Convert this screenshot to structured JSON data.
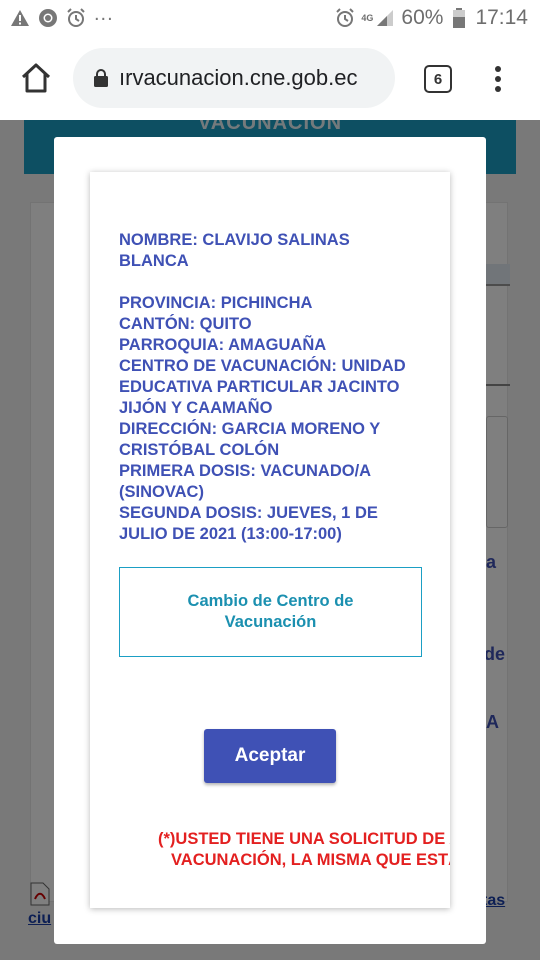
{
  "status_bar": {
    "left_icons": [
      "warning-icon",
      "chrome-icon",
      "alarm-icon"
    ],
    "more": "...",
    "network": "4G",
    "battery": "60%",
    "time": "17:14"
  },
  "browser": {
    "url": "ırvacunacion.cne.gob.ec",
    "tab_count": "6"
  },
  "background_page": {
    "header_title": "VACUNACION",
    "partial_text_1": "a",
    "partial_text_2": "de",
    "partial_text_3": "A",
    "footer_link_1": "ciu",
    "footer_link_2": "tas"
  },
  "modal": {
    "name_line": "NOMBRE: CLAVIJO SALINAS BLANCA",
    "provincia": "PROVINCIA: PICHINCHA",
    "canton": "CANTÓN: QUITO",
    "parroquia": "PARROQUIA: AMAGUAÑA",
    "centro": "CENTRO DE VACUNACIÓN: UNIDAD EDUCATIVA PARTICULAR JACINTO JIJÓN Y CAAMAÑO",
    "direccion": "DIRECCIÓN: GARCIA MORENO Y CRISTÓBAL COLÓN",
    "primera_dosis": "PRIMERA DOSIS: VACUNADO/A (SINOVAC)",
    "segunda_dosis": "SEGUNDA DOSIS: JUEVES, 1 DE JULIO DE 2021 (13:00-17:00)",
    "change_center_label": "Cambio de Centro de Vacunación",
    "accept_label": "Aceptar",
    "notice_line_1": "(*)USTED TIENE UNA SOLICITUD DE ACT",
    "notice_line_2": "VACUNACIÓN, LA MISMA QUE ESTÁ SI"
  },
  "colors": {
    "primary": "#3f51b5",
    "accent": "#1b9fc4",
    "notice": "#e32020"
  }
}
